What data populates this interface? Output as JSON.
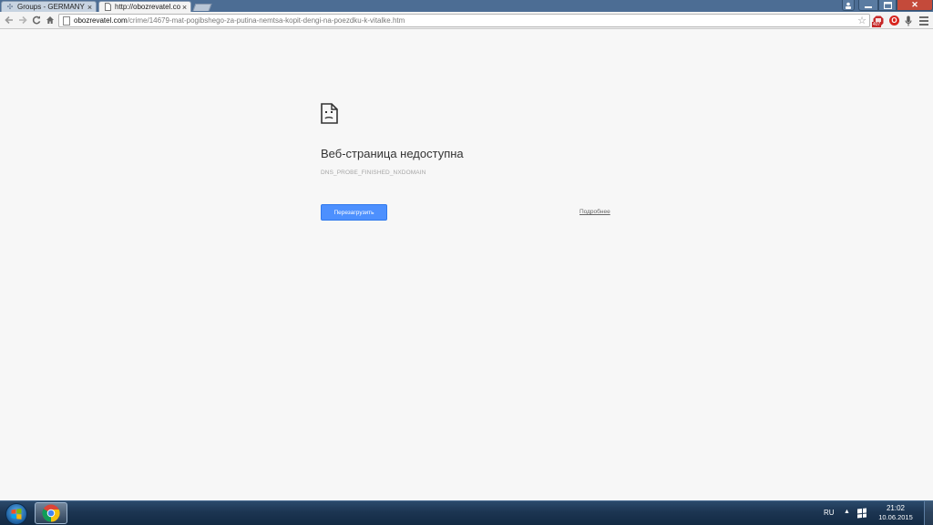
{
  "browser": {
    "tabs": [
      {
        "label": "Groups - GERMANY",
        "active": false
      },
      {
        "label": "http://obozrevatel.co",
        "active": true
      }
    ],
    "url_host": "obozrevatel.com",
    "url_path": "/crime/14679-mat-pogibshego-za-putina-nemtsa-kopit-dengi-na-poezdku-k-vitalke.htm",
    "adblock_badge": "407",
    "opera_label": "O"
  },
  "page": {
    "title": "Веб-страница недоступна",
    "error_code": "DNS_PROBE_FINISHED_NXDOMAIN",
    "reload_label": "Перезагрузить",
    "details_label": "Подробнее"
  },
  "taskbar": {
    "language": "RU",
    "time": "21:02",
    "date": "10.06.2015"
  },
  "colors": {
    "accent_button": "#4d90fe",
    "taskbar": "#1c3552",
    "titlebar": "#4c6d94"
  },
  "icons": [
    "puzzle-icon",
    "page-icon",
    "close-icon",
    "back-icon",
    "forward-icon",
    "reload-icon",
    "home-icon",
    "star-icon",
    "adblock-icon",
    "opera-icon",
    "microphone-icon",
    "menu-icon",
    "sad-page-icon",
    "windows-start-icon",
    "chrome-icon",
    "windows-flag-icon"
  ]
}
